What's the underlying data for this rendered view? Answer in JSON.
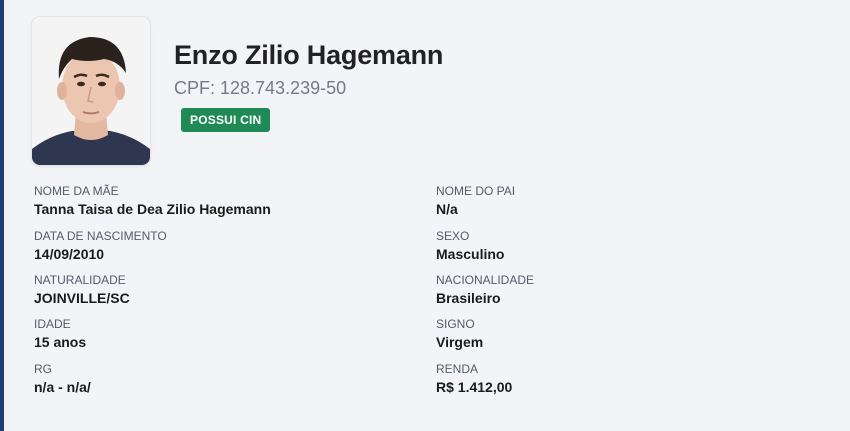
{
  "person": {
    "name": "Enzo Zilio Hagemann",
    "cpf": "CPF: 128.743.239-50",
    "badge": "POSSUI CIN"
  },
  "left_fields": [
    {
      "label": "NOME DA MÃE",
      "value": "Tanna Taisa de Dea Zilio Hagemann"
    },
    {
      "label": "DATA DE NASCIMENTO",
      "value": "14/09/2010"
    },
    {
      "label": "NATURALIDADE",
      "value": "JOINVILLE/SC"
    },
    {
      "label": "IDADE",
      "value": "15 anos"
    },
    {
      "label": "RG",
      "value": "n/a - n/a/"
    }
  ],
  "right_fields": [
    {
      "label": "NOME DO PAI",
      "value": "N/a"
    },
    {
      "label": "SEXO",
      "value": "Masculino"
    },
    {
      "label": "NACIONALIDADE",
      "value": "Brasileiro"
    },
    {
      "label": "SIGNO",
      "value": "Virgem"
    },
    {
      "label": "RENDA",
      "value": "R$ 1.412,00"
    }
  ],
  "colors": {
    "accent_border": "#1f3f73",
    "badge_bg": "#1f8a56",
    "background": "#f2f4f7"
  }
}
